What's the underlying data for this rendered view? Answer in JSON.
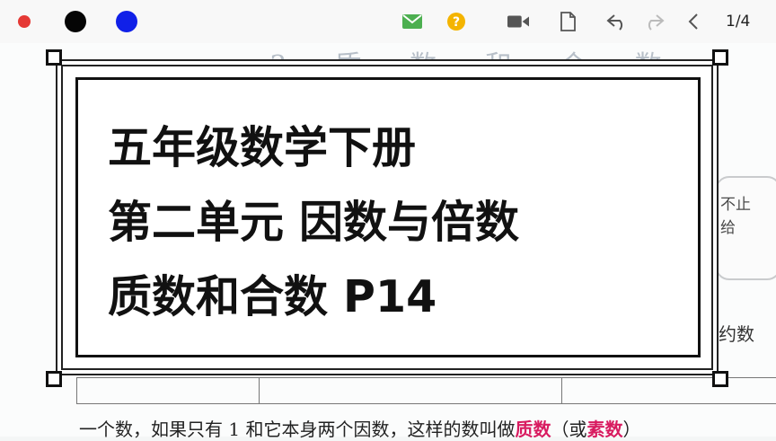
{
  "toolbar": {
    "colors": {
      "red": "#e53935",
      "black": "#050505",
      "blue": "#1020e8"
    },
    "icons": [
      "mail-icon",
      "help-icon",
      "video-icon",
      "document-icon",
      "undo-icon",
      "redo-icon",
      "back-icon"
    ],
    "page_indicator": "1/4"
  },
  "document": {
    "heading": "3 质 数 和 合 数",
    "side_card_text": "不止给",
    "table_header_fragment": "约数",
    "bottom_text_before": "一个数，如果只有 1 和它本身两个因数，这样的数叫做",
    "bottom_text_term1": "质数",
    "bottom_text_mid": "（或",
    "bottom_text_term2": "素数",
    "bottom_text_after": "）"
  },
  "overlay": {
    "line1": "五年级数学下册",
    "line2": "第二单元 因数与倍数",
    "line3": "质数和合数 P14"
  }
}
